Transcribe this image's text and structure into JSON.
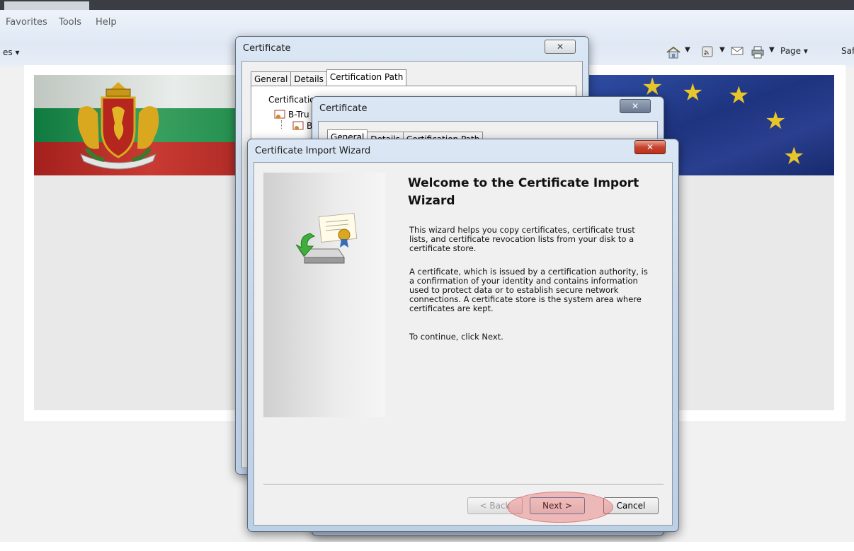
{
  "browser": {
    "menu": [
      "Favorites",
      "Tools",
      "Help"
    ],
    "cmd_left": "es ▾",
    "cmd_page": "Page ▾",
    "cmd_safety": "Saf",
    "icons": [
      "home-icon",
      "feeds-icon",
      "mail-icon",
      "print-icon"
    ]
  },
  "cert_window_1": {
    "title": "Certificate",
    "tabs": [
      "General",
      "Details",
      "Certification Path"
    ],
    "group_label": "Certificatio",
    "tree_item_1": "B-Tru",
    "tree_item_2": "B"
  },
  "cert_window_2": {
    "title": "Certificate",
    "tabs": [
      "General",
      "Details",
      "Certification Path"
    ]
  },
  "wizard": {
    "title": "Certificate Import Wizard",
    "heading": "Welcome to the Certificate Import Wizard",
    "para1": "This wizard helps you copy certificates, certificate trust lists, and certificate revocation lists from your disk to a certificate store.",
    "para2": "A certificate, which is issued by a certification authority, is a confirmation of your identity and contains information used to protect data or to establish secure network connections. A certificate store is the system area where certificates are kept.",
    "para3": "To continue, click Next.",
    "back_label": "< Back",
    "next_label": "Next >",
    "cancel_label": "Cancel"
  },
  "colors": {
    "highlight": "#e85050",
    "close_red": "#c9442f"
  }
}
